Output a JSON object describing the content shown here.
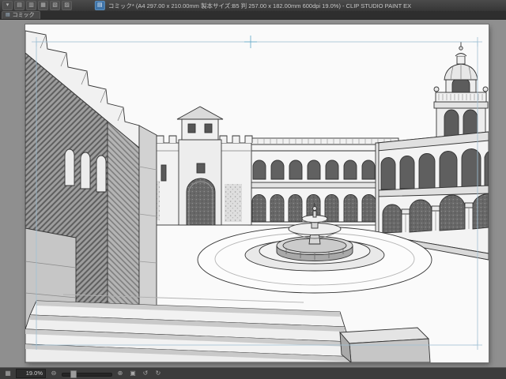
{
  "window": {
    "title": "コミック* (A4 297.00 x 210.00mm 製本サイズ:B5 判 257.00 x 182.00mm 600dpi 19.0%) - CLIP STUDIO PAINT EX"
  },
  "titlebar": {
    "icons": [
      {
        "name": "menu-icon",
        "glyph": "▾"
      },
      {
        "name": "page-manager-icon",
        "glyph": "▤"
      },
      {
        "name": "spread-view-icon",
        "glyph": "▥"
      },
      {
        "name": "grid-icon",
        "glyph": "▦"
      },
      {
        "name": "story-editor-icon",
        "glyph": "▧"
      },
      {
        "name": "layout-icon",
        "glyph": "▨"
      }
    ],
    "document_icon": {
      "name": "active-document-icon",
      "glyph": "▤"
    }
  },
  "tabbar": {
    "tab": {
      "icon_glyph": "▤",
      "label": "コミック"
    }
  },
  "statusbar": {
    "left_icon_glyph": "▦",
    "zoom_value": "19.0%",
    "zoom_out_glyph": "⊖",
    "zoom_in_glyph": "⊕",
    "fit_glyph": "▣",
    "rotate_left_glyph": "↺",
    "rotate_right_glyph": "↻"
  },
  "colors": {
    "chrome": "#3e3e3e",
    "chrome_dark": "#2c2c2c",
    "canvas_background": "#8f8f8f",
    "page": "#fafafa",
    "accent_blue": "#3e73a8",
    "guide_blue": "#8cb6cc",
    "ink": "#2e2e2e"
  }
}
